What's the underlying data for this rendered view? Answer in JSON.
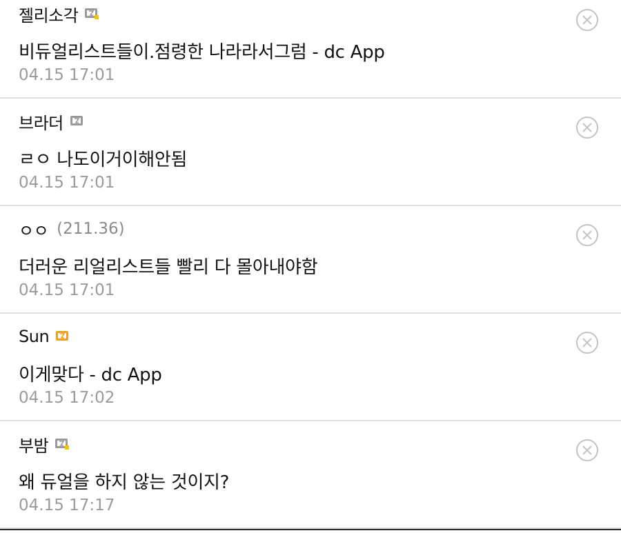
{
  "comments": [
    {
      "author": "젤리소각",
      "ip": "",
      "badge": "gray-fixed-gallog-icon",
      "text": "비듀얼리스트들이.점령한 나라라서그럼 - dc App",
      "date": "04.15 17:01"
    },
    {
      "author": "브라더",
      "ip": "",
      "badge": "gray-gallog-icon",
      "text": "ㄹㅇ 나도이거이해안됨",
      "date": "04.15 17:01"
    },
    {
      "author": "ㅇㅇ",
      "ip": "(211.36)",
      "badge": "",
      "text": "더러운 리얼리스트들 빨리 다 몰아내야함",
      "date": "04.15 17:01"
    },
    {
      "author": "Sun",
      "ip": "",
      "badge": "orange-gallog-icon",
      "text": "이게맞다 - dc App",
      "date": "04.15 17:02"
    },
    {
      "author": "부밤",
      "ip": "",
      "badge": "gray-fixed-gallog-icon",
      "text": "왜 듀얼을 하지 않는 것이지?",
      "date": "04.15 17:17"
    }
  ],
  "colors": {
    "author": "#111111",
    "ip": "#8a8a8a",
    "date": "#9a9a9a",
    "divider": "#dedee3",
    "delete_icon": "#c4c4c4",
    "badge_gray": "#9a9a9a",
    "badge_orange": "#f0a020",
    "badge_dot": "#f6c400"
  }
}
